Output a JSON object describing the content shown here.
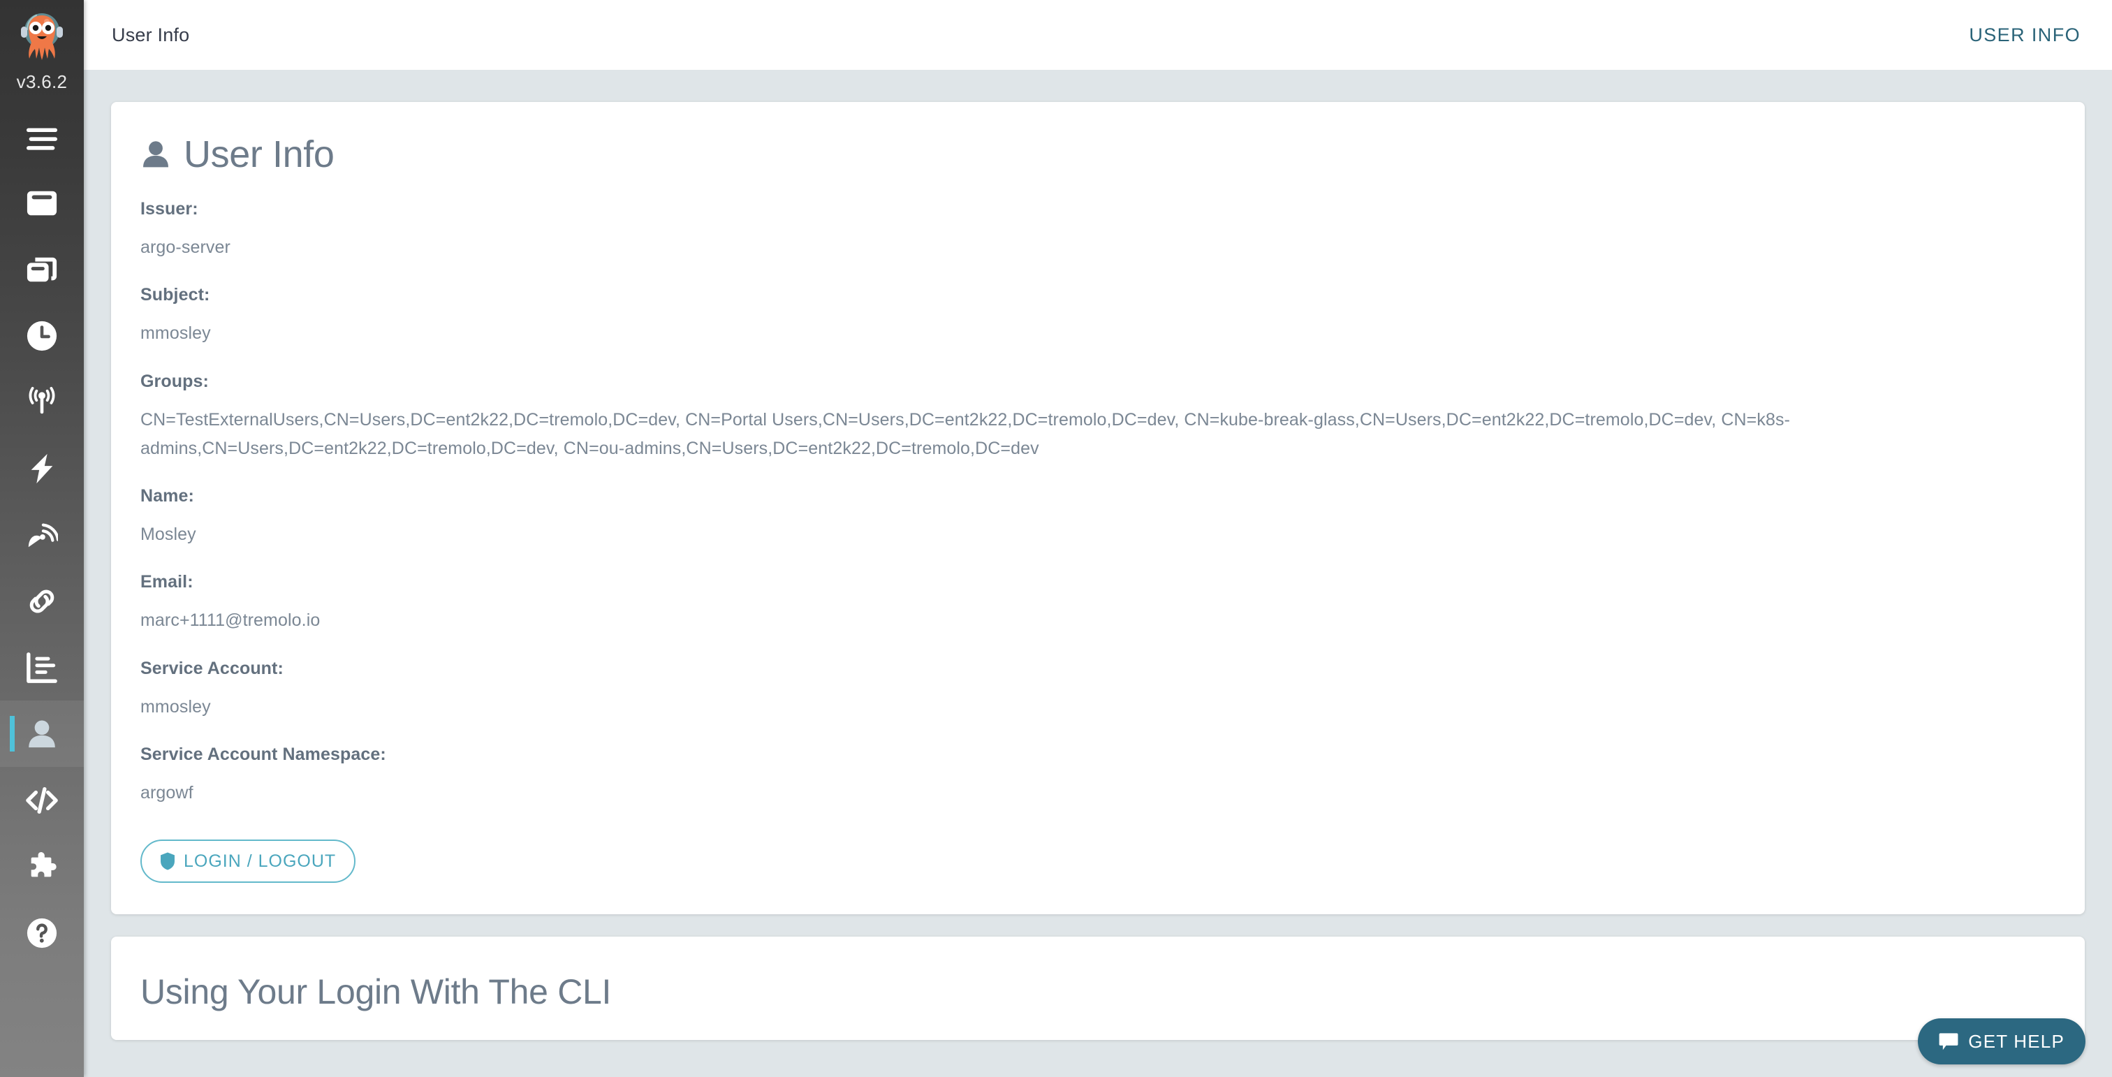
{
  "app": {
    "version": "v3.6.2",
    "logo_icon": "argo-octopus-logo"
  },
  "sidebar": {
    "items": [
      {
        "name": "menu-toggle",
        "icon": "hamburger-icon",
        "active": false
      },
      {
        "name": "workflows",
        "icon": "window-icon",
        "active": false
      },
      {
        "name": "workflow-templates",
        "icon": "windows-stack-icon",
        "active": false
      },
      {
        "name": "cron-workflows",
        "icon": "clock-icon",
        "active": false
      },
      {
        "name": "event-flow",
        "icon": "broadcast-icon",
        "active": false
      },
      {
        "name": "event-sources",
        "icon": "bolt-icon",
        "active": false
      },
      {
        "name": "sensors",
        "icon": "satellite-dish-icon",
        "active": false
      },
      {
        "name": "workflow-event-bindings",
        "icon": "link-icon",
        "active": false
      },
      {
        "name": "reports",
        "icon": "bar-chart-icon",
        "active": false
      },
      {
        "name": "user-info",
        "icon": "user-icon",
        "active": true
      },
      {
        "name": "api-docs",
        "icon": "code-icon",
        "active": false
      },
      {
        "name": "plugins",
        "icon": "puzzle-icon",
        "active": false
      },
      {
        "name": "help",
        "icon": "question-circle-icon",
        "active": false
      }
    ]
  },
  "header": {
    "title": "User Info",
    "right_label": "USER INFO"
  },
  "user_info": {
    "heading": "User Info",
    "heading_icon": "user-icon",
    "fields": [
      {
        "label": "Issuer:",
        "value": "argo-server"
      },
      {
        "label": "Subject:",
        "value": "mmosley"
      },
      {
        "label": "Groups:",
        "value": "CN=TestExternalUsers,CN=Users,DC=ent2k22,DC=tremolo,DC=dev, CN=Portal Users,CN=Users,DC=ent2k22,DC=tremolo,DC=dev, CN=kube-break-glass,CN=Users,DC=ent2k22,DC=tremolo,DC=dev, CN=k8s-admins,CN=Users,DC=ent2k22,DC=tremolo,DC=dev, CN=ou-admins,CN=Users,DC=ent2k22,DC=tremolo,DC=dev"
      },
      {
        "label": "Name:",
        "value": "Mosley"
      },
      {
        "label": "Email:",
        "value": "marc+1111@tremolo.io"
      },
      {
        "label": "Service Account:",
        "value": "mmosley"
      },
      {
        "label": "Service Account Namespace:",
        "value": "argowf"
      }
    ],
    "login_logout_label": "LOGIN / LOGOUT",
    "login_logout_icon": "shield-icon"
  },
  "cli_section": {
    "title": "Using Your Login With The CLI"
  },
  "get_help": {
    "label": "GET HELP",
    "icon": "chat-bubble-icon"
  },
  "colors": {
    "page_background": "#dfe5e8",
    "card_background": "#ffffff",
    "accent_cyan": "#4fc1d9",
    "accent_teal": "#2c6881",
    "text_muted": "#7b8794",
    "label_text": "#63707e"
  }
}
